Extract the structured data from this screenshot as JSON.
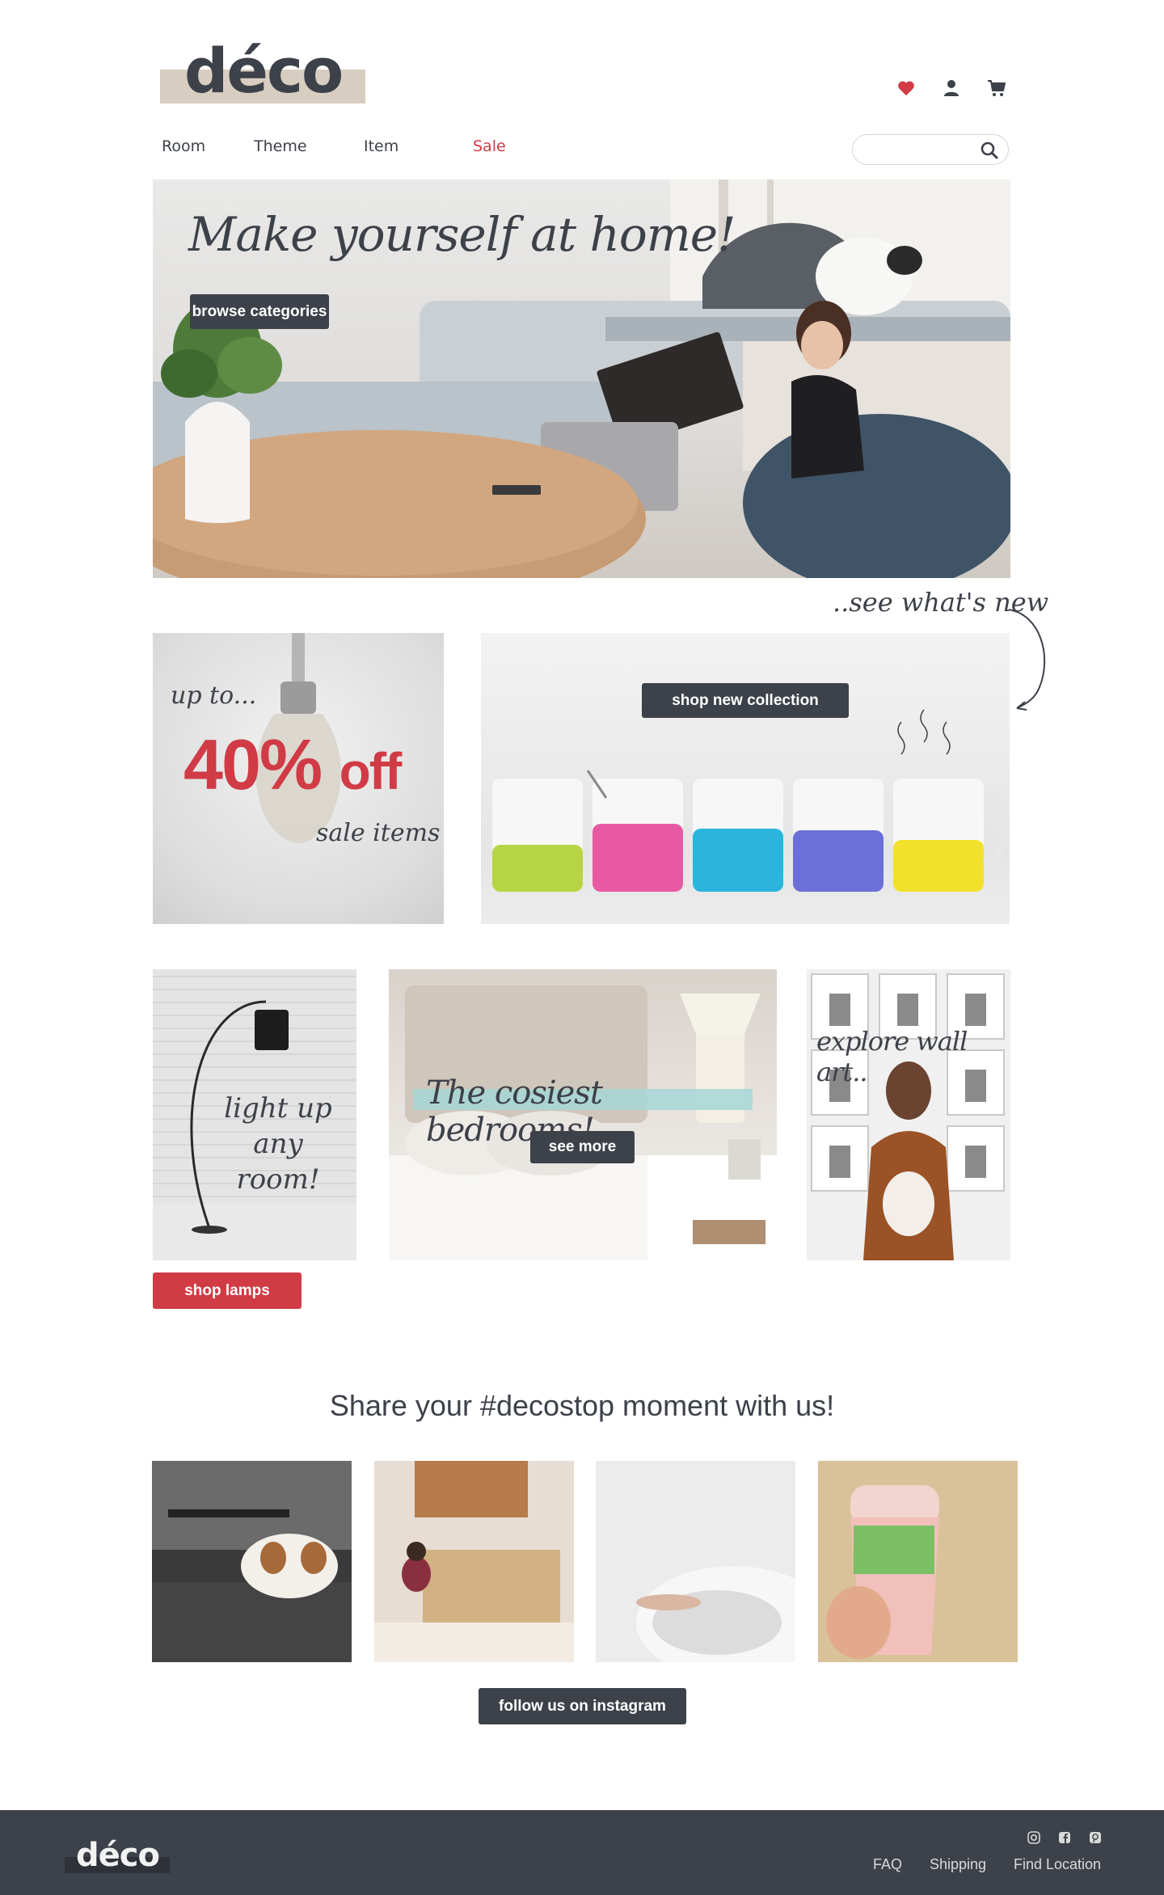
{
  "header": {
    "logo_text": "déco",
    "icons": [
      "heart-icon",
      "user-icon",
      "cart-icon"
    ],
    "accent_color": "#d03b45",
    "logo_bar_color": "#d8cdc1"
  },
  "nav": {
    "items": [
      {
        "label": "Room"
      },
      {
        "label": "Theme"
      },
      {
        "label": "Item"
      },
      {
        "label": "Sale"
      }
    ],
    "sale_color": "#d03b45"
  },
  "search": {
    "placeholder": "",
    "icon": "search-icon"
  },
  "hero": {
    "title": "Make yourself at home!",
    "button_label": "browse categories"
  },
  "see_whats_new": "..see what's new",
  "sale_tile": {
    "up_to": "up to...",
    "percent": "40%",
    "off": "off",
    "sale_items": "sale items"
  },
  "collection_tile": {
    "button_label": "shop new collection"
  },
  "lamp_tile": {
    "line1": "light up",
    "line2": "any room!",
    "button_label": "shop lamps"
  },
  "bedroom_tile": {
    "title": "The cosiest bedrooms!",
    "button_label": "see more"
  },
  "wall_tile": {
    "title": "explore wall art.."
  },
  "share": {
    "title": "Share your #decostop moment with us!",
    "button_label": "follow us on instagram"
  },
  "footer": {
    "logo_text": "déco",
    "social_icons": [
      "instagram-icon",
      "facebook-icon",
      "pinterest-icon"
    ],
    "links": [
      {
        "label": "FAQ"
      },
      {
        "label": "Shipping"
      },
      {
        "label": "Find Location"
      }
    ],
    "background_color": "#3d4149"
  }
}
